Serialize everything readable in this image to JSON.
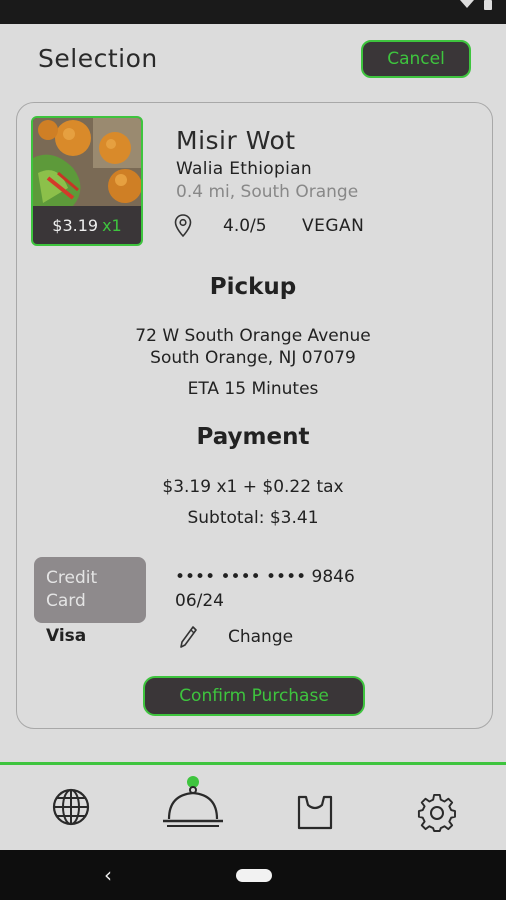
{
  "header": {
    "title": "Selection",
    "cancel_label": "Cancel"
  },
  "item": {
    "price": "$3.19",
    "qty": "x1",
    "name": "Misir Wot",
    "restaurant": "Walia Ethiopian",
    "distance": "0.4 mi, South Orange",
    "rating": "4.0/5",
    "diet": "VEGAN"
  },
  "pickup": {
    "title": "Pickup",
    "address_line1": "72 W South Orange Avenue",
    "address_line2": "South Orange, NJ 07079",
    "eta": "ETA 15 Minutes"
  },
  "payment": {
    "title": "Payment",
    "breakdown": "$3.19 x1 + $0.22 tax",
    "subtotal": "Subtotal: $3.41",
    "method_line1": "Credit",
    "method_line2": "Card",
    "brand": "Visa",
    "card_number": "•••• •••• •••• 9846",
    "expiry": "06/24",
    "change_label": "Change",
    "confirm_label": "Confirm Purchase"
  },
  "nav": {
    "items": [
      "globe-icon",
      "cloche-icon",
      "bag-icon",
      "settings-icon"
    ],
    "active": "cloche-icon"
  },
  "colors": {
    "accent": "#3ec43e",
    "dark": "#3a3638",
    "background": "#dcdcdc"
  }
}
